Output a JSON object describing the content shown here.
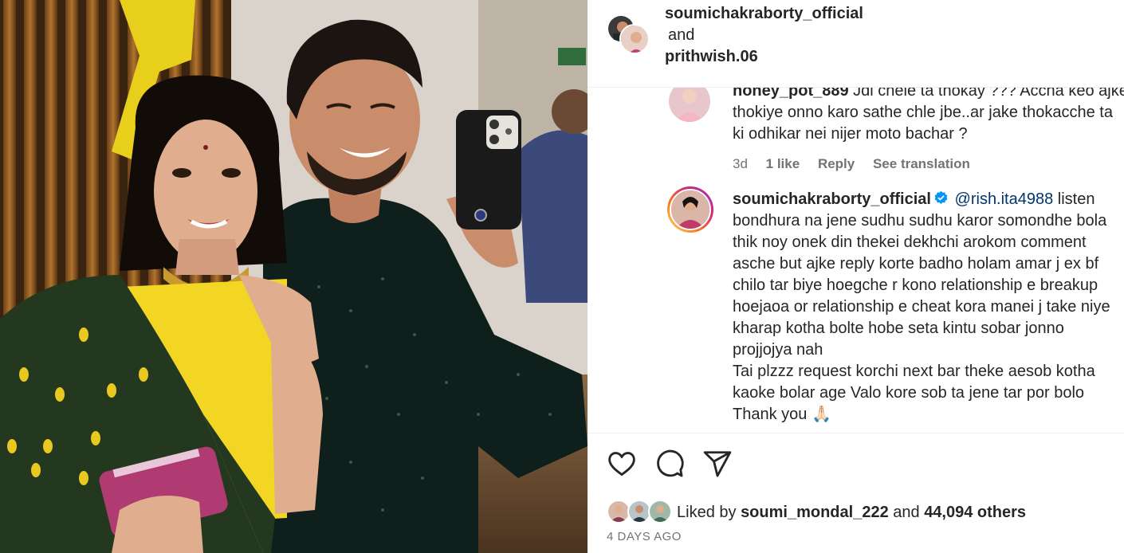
{
  "header": {
    "user1": "soumichakraborty_official",
    "joiner": "and",
    "user2": "prithwish.06"
  },
  "comments": [
    {
      "username": "honey_pot_889",
      "lines": [
        "Jdi chele ta thokay ??? Accha keo ajke",
        "thokiye onno karo sathe chle jbe..ar jake thokacche ta",
        "ki odhikar nei nijer moto bachar ?"
      ],
      "age": "3d",
      "likes": "1 like",
      "reply": "Reply",
      "translate": "See translation"
    },
    {
      "username": "soumichakraborty_official",
      "mention": "@rish.ita4988",
      "first_line_rest": "listen",
      "lines": [
        "bondhura na jene sudhu sudhu karor somondhe bola",
        "thik noy onek din thekei dekhchi arokom comment",
        "asche but ajke reply korte badho holam amar j ex bf",
        "chilo tar biye hoegche r kono relationship e breakup",
        "hoejaoa or relationship e cheat kora manei j take niye",
        "kharap kotha bolte hobe seta kintu sobar jonno",
        "projjojya nah",
        "Tai plzzz request korchi next bar theke aesob kotha",
        "kaoke bolar age Valo kore sob ta jene tar por bolo",
        "Thank you 🙏🏻"
      ]
    }
  ],
  "actions": {
    "like_icon": "heart-icon",
    "comment_icon": "comment-icon",
    "share_icon": "share-icon"
  },
  "likes": {
    "prefix": "Liked by",
    "user": "soumi_mondal_222",
    "middle": "and",
    "count": "44,094 others"
  },
  "timestamp": "4 DAYS AGO",
  "colors": {
    "verified": "#0095f6",
    "mention": "#00376b",
    "muted": "#737373",
    "story_ring": [
      "#feda75",
      "#fa7e1e",
      "#d62976",
      "#962fbf"
    ]
  }
}
